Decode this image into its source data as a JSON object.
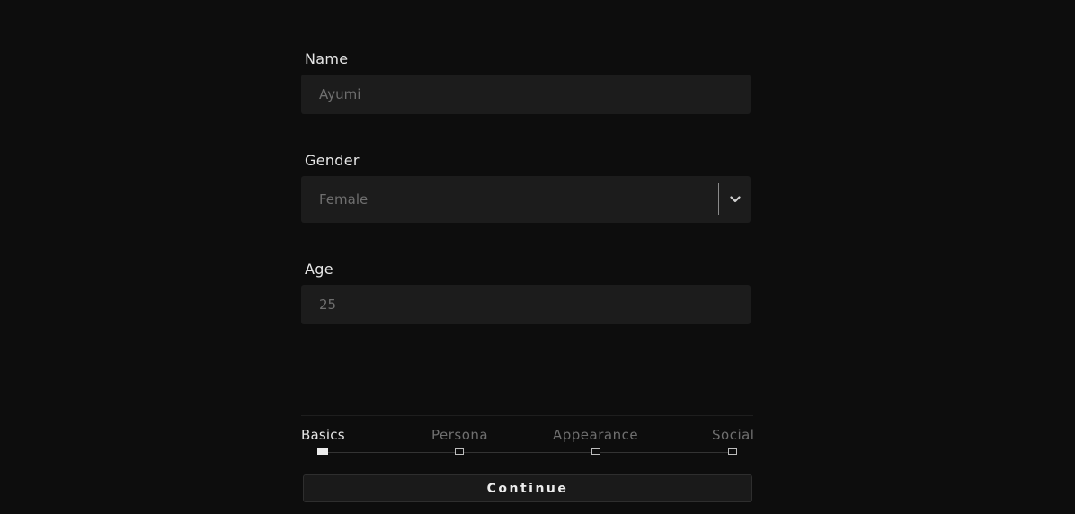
{
  "form": {
    "name": {
      "label": "Name",
      "placeholder": "Ayumi"
    },
    "gender": {
      "label": "Gender",
      "value": "Female"
    },
    "age": {
      "label": "Age",
      "placeholder": "25"
    }
  },
  "steps": [
    {
      "label": "Basics",
      "active": true
    },
    {
      "label": "Persona",
      "active": false
    },
    {
      "label": "Appearance",
      "active": false
    },
    {
      "label": "Social",
      "active": false
    }
  ],
  "actions": {
    "continue_label": "Continue"
  },
  "icons": {
    "select_toggle": "chevron-down-icon"
  },
  "colors": {
    "background": "#0d0d0d",
    "field": "#1c1c1c",
    "text": "#e6e6e6",
    "muted": "#6f6f6f"
  }
}
